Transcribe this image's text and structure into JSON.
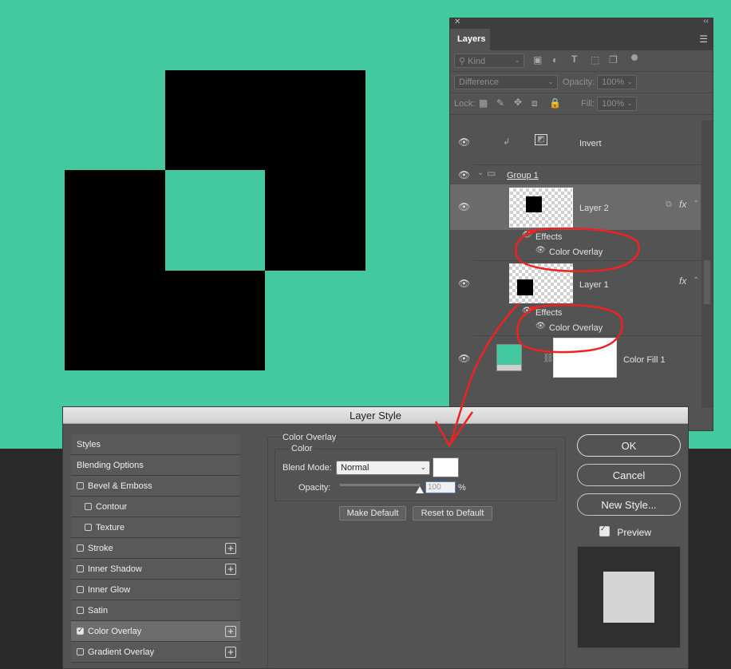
{
  "colors": {
    "canvas": "#44c8a0",
    "pasteboard": "#2a2a2a",
    "annotation": "#ee2222"
  },
  "layers_panel": {
    "tab_label": "Layers",
    "kind_filter": "Kind",
    "blend_mode": "Difference",
    "opacity_label": "Opacity:",
    "opacity_value": "100%",
    "lock_label": "Lock:",
    "fill_label": "Fill:",
    "fill_value": "100%",
    "layers": {
      "invert": {
        "name": "Invert"
      },
      "group1": {
        "name": "Group 1"
      },
      "layer2": {
        "name": "Layer 2",
        "effects_label": "Effects",
        "effect_name": "Color Overlay"
      },
      "layer1": {
        "name": "Layer 1",
        "effects_label": "Effects",
        "effect_name": "Color Overlay"
      },
      "colorfill": {
        "name": "Color Fill 1"
      }
    },
    "fx_label": "fx"
  },
  "layer_style": {
    "title": "Layer Style",
    "styles_list": [
      {
        "label": "Styles",
        "checkbox": false,
        "checked": false,
        "plus": false,
        "indent": false
      },
      {
        "label": "Blending Options",
        "checkbox": false,
        "checked": false,
        "plus": false,
        "indent": false
      },
      {
        "label": "Bevel & Emboss",
        "checkbox": true,
        "checked": false,
        "plus": false,
        "indent": false
      },
      {
        "label": "Contour",
        "checkbox": true,
        "checked": false,
        "plus": false,
        "indent": true
      },
      {
        "label": "Texture",
        "checkbox": true,
        "checked": false,
        "plus": false,
        "indent": true
      },
      {
        "label": "Stroke",
        "checkbox": true,
        "checked": false,
        "plus": true,
        "indent": false
      },
      {
        "label": "Inner Shadow",
        "checkbox": true,
        "checked": false,
        "plus": true,
        "indent": false
      },
      {
        "label": "Inner Glow",
        "checkbox": true,
        "checked": false,
        "plus": false,
        "indent": false
      },
      {
        "label": "Satin",
        "checkbox": true,
        "checked": false,
        "plus": false,
        "indent": false
      },
      {
        "label": "Color Overlay",
        "checkbox": true,
        "checked": true,
        "plus": true,
        "indent": false
      },
      {
        "label": "Gradient Overlay",
        "checkbox": true,
        "checked": false,
        "plus": true,
        "indent": false
      }
    ],
    "section_title": "Color Overlay",
    "group_title": "Color",
    "blend_mode_label": "Blend Mode:",
    "blend_mode_value": "Normal",
    "overlay_color": "#ffffff",
    "opacity_label": "Opacity:",
    "opacity_value": "100",
    "opacity_unit": "%",
    "opacity_level": 1.0,
    "make_default": "Make Default",
    "reset_default": "Reset to Default",
    "ok": "OK",
    "cancel": "Cancel",
    "new_style": "New Style...",
    "preview_label": "Preview",
    "preview_checked": true
  }
}
